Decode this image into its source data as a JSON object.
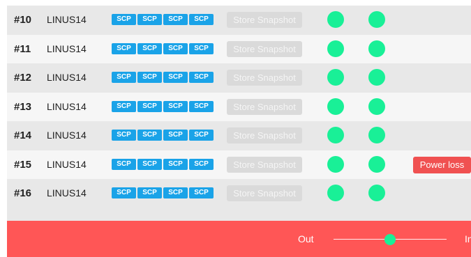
{
  "rows": [
    {
      "num": "#10",
      "host": "LINUS14",
      "scp": [
        "SCP",
        "SCP",
        "SCP",
        "SCP"
      ],
      "snapshot": "Store Snapshot",
      "alert": ""
    },
    {
      "num": "#11",
      "host": "LINUS14",
      "scp": [
        "SCP",
        "SCP",
        "SCP",
        "SCP"
      ],
      "snapshot": "Store Snapshot",
      "alert": ""
    },
    {
      "num": "#12",
      "host": "LINUS14",
      "scp": [
        "SCP",
        "SCP",
        "SCP",
        "SCP"
      ],
      "snapshot": "Store Snapshot",
      "alert": ""
    },
    {
      "num": "#13",
      "host": "LINUS14",
      "scp": [
        "SCP",
        "SCP",
        "SCP",
        "SCP"
      ],
      "snapshot": "Store Snapshot",
      "alert": ""
    },
    {
      "num": "#14",
      "host": "LINUS14",
      "scp": [
        "SCP",
        "SCP",
        "SCP",
        "SCP"
      ],
      "snapshot": "Store Snapshot",
      "alert": ""
    },
    {
      "num": "#15",
      "host": "LINUS14",
      "scp": [
        "SCP",
        "SCP",
        "SCP",
        "SCP"
      ],
      "snapshot": "Store Snapshot",
      "alert": "Power loss"
    },
    {
      "num": "#16",
      "host": "LINUS14",
      "scp": [
        "SCP",
        "SCP",
        "SCP",
        "SCP"
      ],
      "snapshot": "Store Snapshot",
      "alert": ""
    }
  ],
  "footer": {
    "out_label": "Out",
    "in_label": "In",
    "slider_value": 0.5
  },
  "colors": {
    "status_green": "#19f097",
    "scp_blue": "#1aa3e8",
    "alert_red": "#f05151",
    "footer_red": "#ff5656"
  }
}
